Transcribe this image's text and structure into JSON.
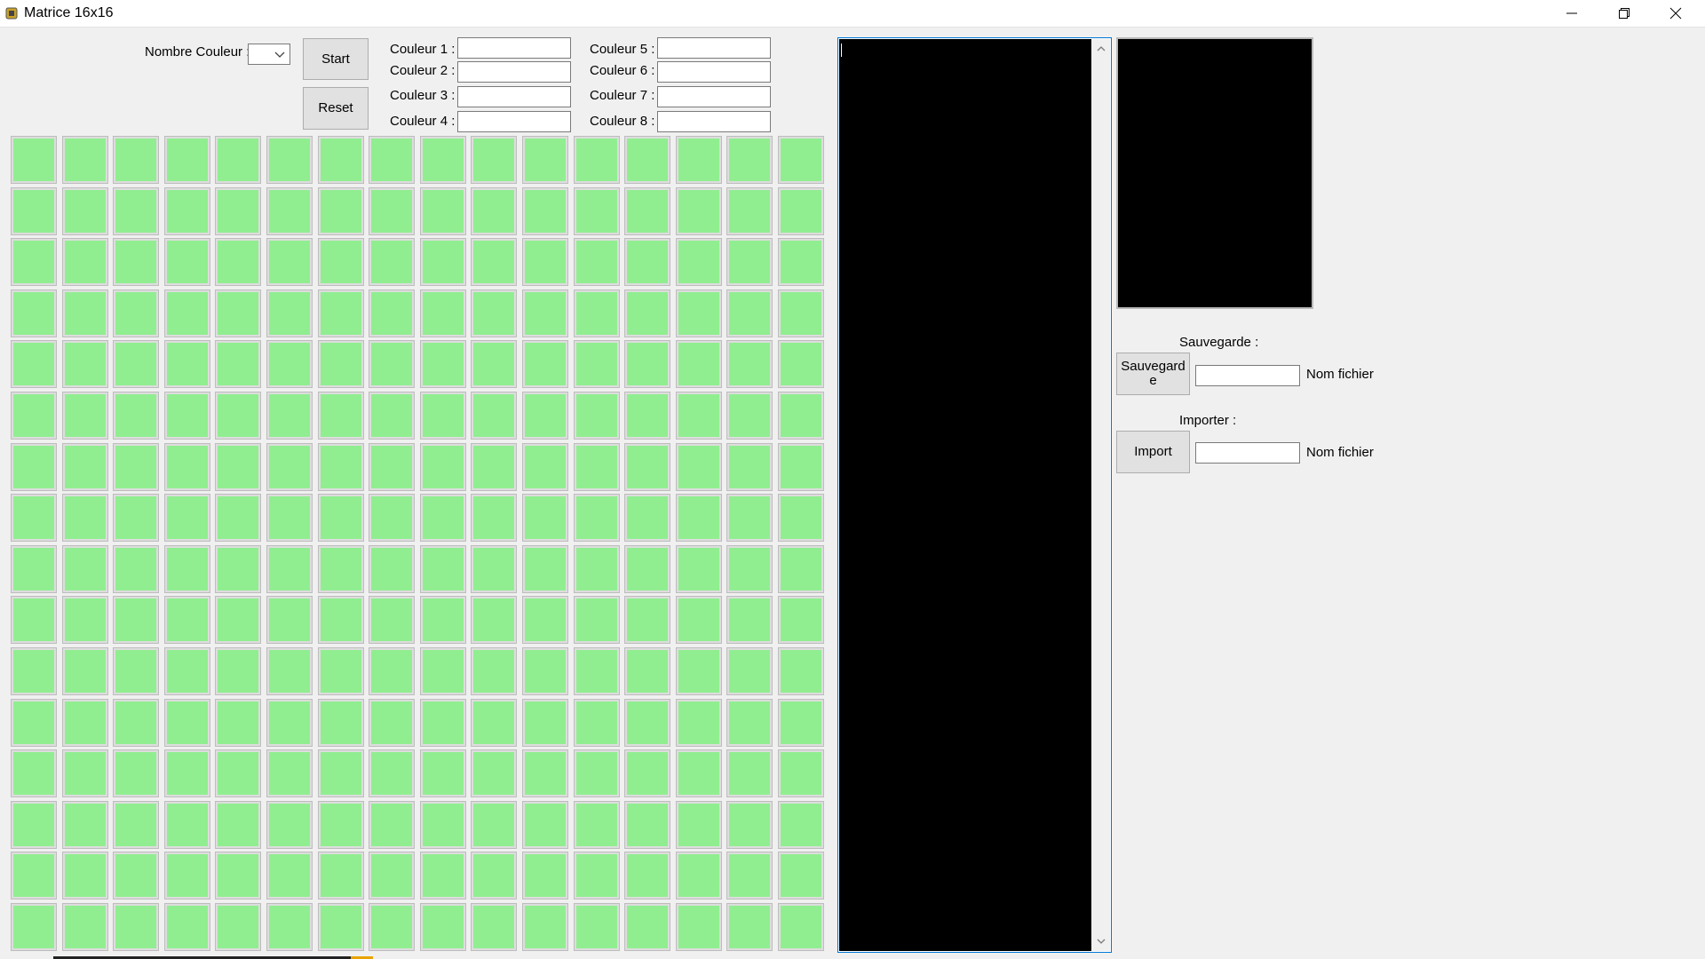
{
  "window": {
    "title": "Matrice 16x16"
  },
  "controls": {
    "color_count_label": "Nombre Couleur :",
    "color_count_value": "",
    "start_label": "Start",
    "reset_label": "Reset"
  },
  "colors": [
    {
      "label": "Couleur 1 :",
      "value": ""
    },
    {
      "label": "Couleur 2 :",
      "value": ""
    },
    {
      "label": "Couleur 3 :",
      "value": ""
    },
    {
      "label": "Couleur 4 :",
      "value": ""
    },
    {
      "label": "Couleur 5 :",
      "value": ""
    },
    {
      "label": "Couleur 6 :",
      "value": ""
    },
    {
      "label": "Couleur 7 :",
      "value": ""
    },
    {
      "label": "Couleur 8 :",
      "value": ""
    }
  ],
  "matrix": {
    "rows": 16,
    "cols": 16,
    "cell_color": "#90ee90"
  },
  "log": {
    "text": ""
  },
  "save": {
    "section_label": "Sauvegarde :",
    "button_label": "Sauvegard\ne",
    "filename_value": "",
    "filename_label": "Nom fichier"
  },
  "import": {
    "section_label": "Importer :",
    "button_label": "Import",
    "filename_value": "",
    "filename_label": "Nom fichier"
  },
  "icons": {
    "app": "app-icon",
    "minimize": "minimize-icon",
    "maximize": "restore-icon",
    "close": "close-icon",
    "dropdown": "chevron-down-icon",
    "scroll_up": "scroll-up-icon",
    "scroll_down": "scroll-down-icon"
  },
  "theme": {
    "window_bg": "#f0f0f0",
    "focus_border": "#0078d7",
    "cell_green": "#90ee90"
  }
}
